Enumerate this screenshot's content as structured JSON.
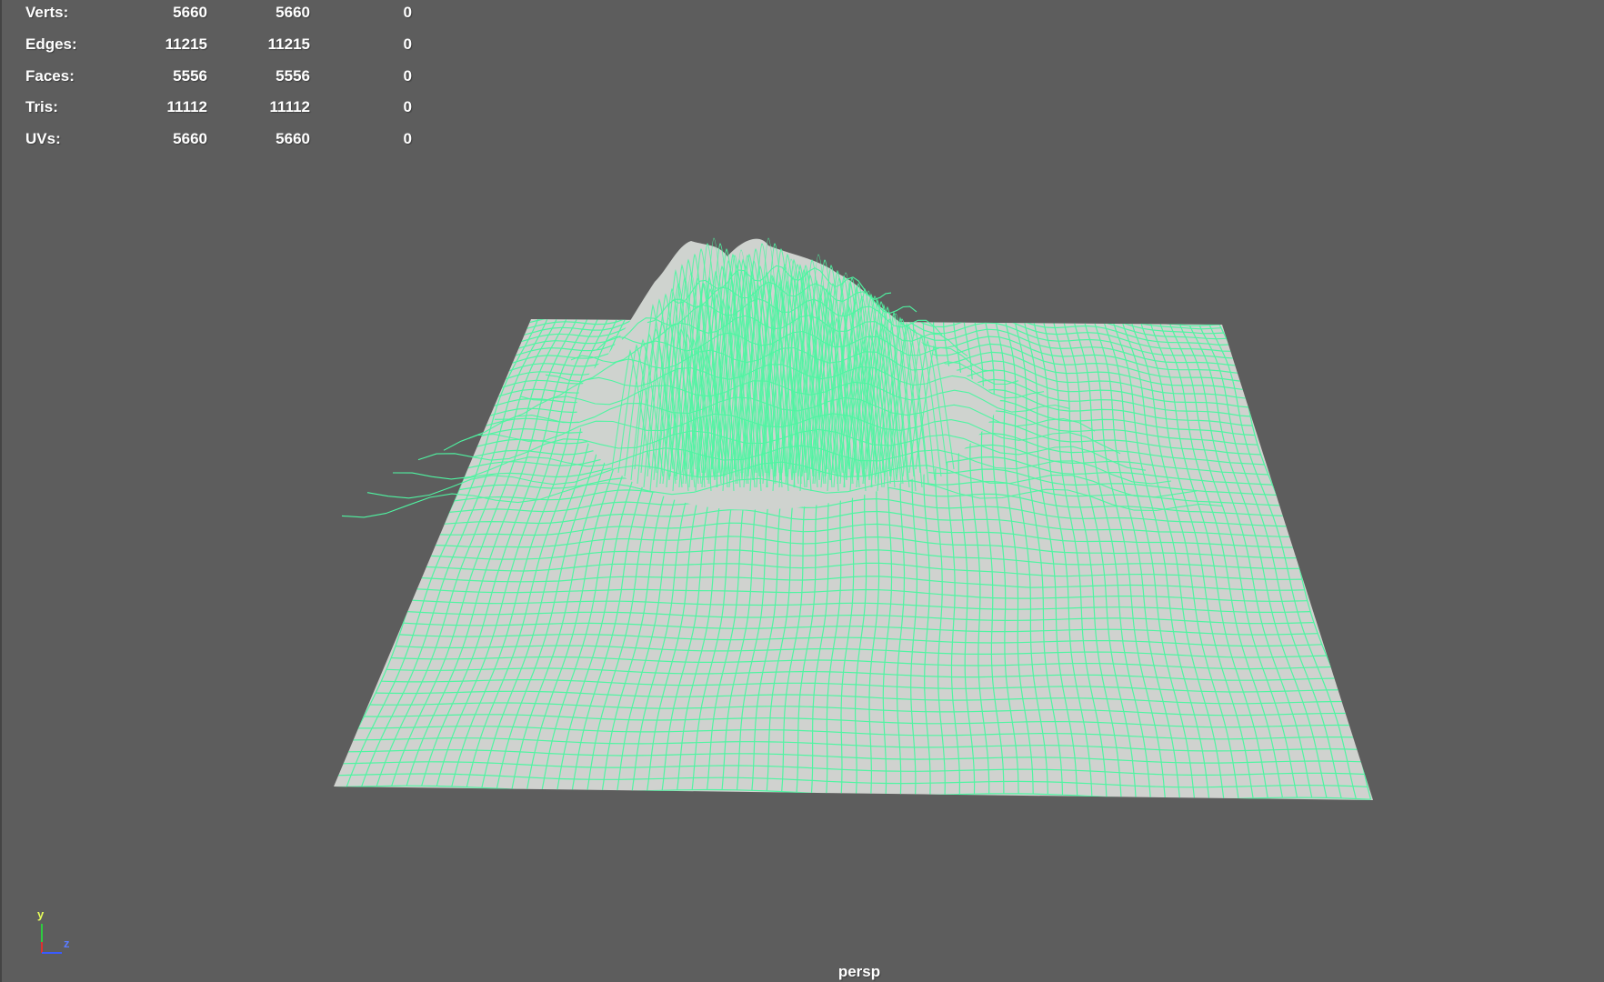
{
  "hud": {
    "rows": [
      {
        "label": "Verts:",
        "c1": "5660",
        "c2": "5660",
        "c3": "0"
      },
      {
        "label": "Edges:",
        "c1": "11215",
        "c2": "11215",
        "c3": "0"
      },
      {
        "label": "Faces:",
        "c1": "5556",
        "c2": "5556",
        "c3": "0"
      },
      {
        "label": "Tris:",
        "c1": "11112",
        "c2": "11112",
        "c3": "0"
      },
      {
        "label": "UVs:",
        "c1": "5660",
        "c2": "5660",
        "c3": "0"
      }
    ]
  },
  "viewport": {
    "camera": "persp",
    "background_color": "#5d5d5d",
    "mesh_fill_color": "#d0d2cf",
    "wire_color": "#4ff5a2"
  },
  "axis_gizmo": {
    "y_label": "y",
    "z_label": "z",
    "x_color": "#e03030",
    "y_color": "#2ecc40",
    "z_color": "#3a5bff"
  },
  "icons": {
    "axis": "axis-gizmo-icon"
  }
}
